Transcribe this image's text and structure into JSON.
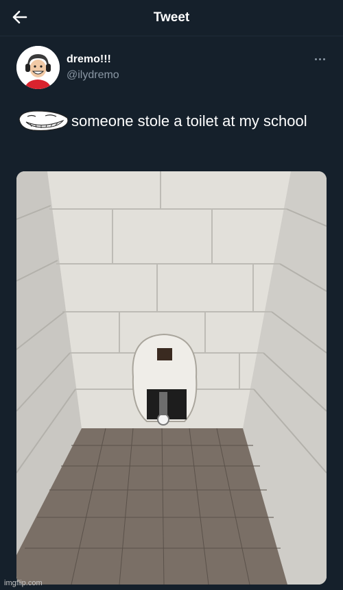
{
  "header": {
    "title": "Tweet",
    "back_icon": "arrow-left-icon"
  },
  "author": {
    "name": "dremo!!!",
    "handle": "@ilydremo",
    "avatar_icon": "avatar-cartoon"
  },
  "tweet": {
    "emoji_icon": "trollface-icon",
    "text": "someone stole a toilet at my school"
  },
  "media": {
    "description_icon": "photo"
  },
  "watermark": "imgflip.com",
  "colors": {
    "background": "#15202b",
    "text": "#ffffff",
    "secondary_text": "#8b98a5"
  }
}
